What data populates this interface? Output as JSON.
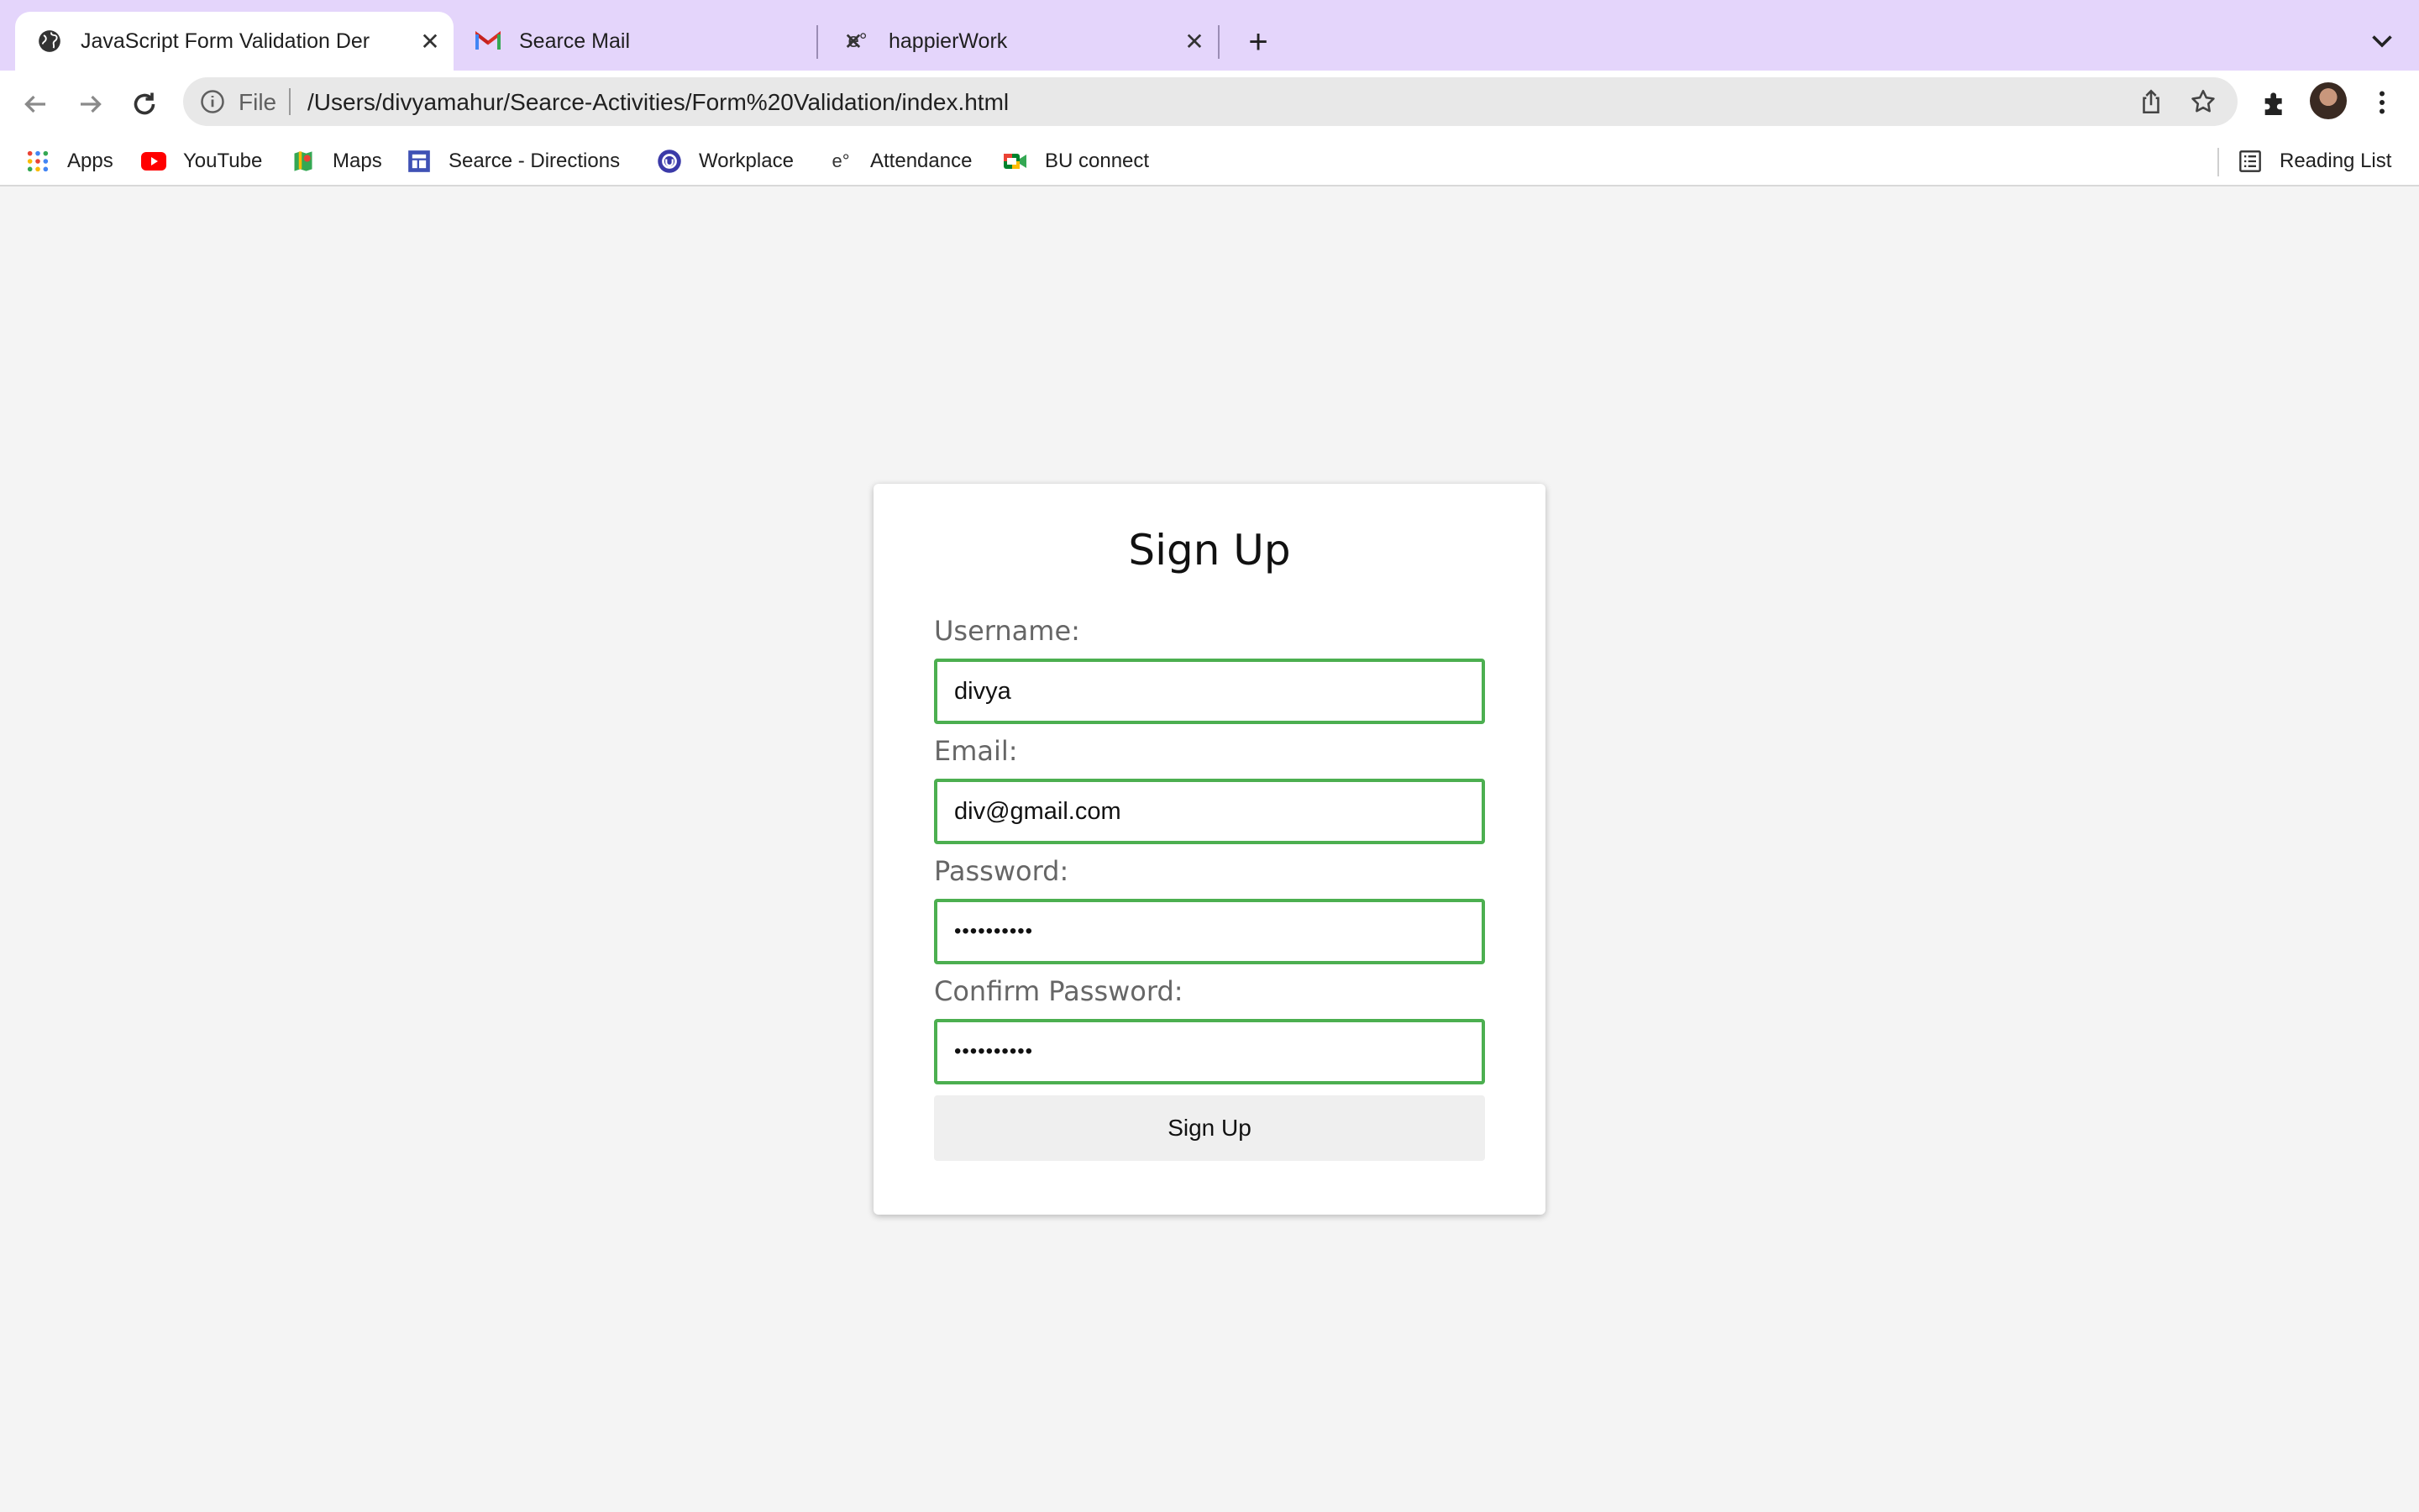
{
  "browser": {
    "tabs": [
      {
        "title": "JavaScript Form Validation Der",
        "icon": "globe-icon",
        "active": true
      },
      {
        "title": "Searce Mail",
        "icon": "gmail-icon",
        "active": false
      },
      {
        "title": "happierWork",
        "icon": "happierwork-icon",
        "active": false
      }
    ],
    "new_tab": "+",
    "close_glyph": "✕",
    "omnibox": {
      "scheme_label": "File",
      "url": "/Users/divyamahur/Searce-Activities/Form%20Validation/index.html"
    },
    "bookmarks": [
      {
        "label": "Apps",
        "icon": "apps-grid-icon"
      },
      {
        "label": "YouTube",
        "icon": "youtube-icon"
      },
      {
        "label": "Maps",
        "icon": "maps-icon"
      },
      {
        "label": "Searce - Directions",
        "icon": "directions-icon"
      },
      {
        "label": "Workplace",
        "icon": "workplace-icon"
      },
      {
        "label": "Attendance",
        "icon": "attendance-icon"
      },
      {
        "label": "BU connect",
        "icon": "meet-icon"
      }
    ],
    "reading_list": "Reading List"
  },
  "form": {
    "title": "Sign Up",
    "fields": [
      {
        "label": "Username:",
        "value": "divya",
        "type": "text"
      },
      {
        "label": "Email:",
        "value": "div@gmail.com",
        "type": "email"
      },
      {
        "label": "Password:",
        "value": "••••••••••",
        "type": "password"
      },
      {
        "label": "Confirm Password:",
        "value": "••••••••••",
        "type": "password"
      }
    ],
    "submit_label": "Sign Up",
    "valid_border_color": "#4caf50"
  }
}
